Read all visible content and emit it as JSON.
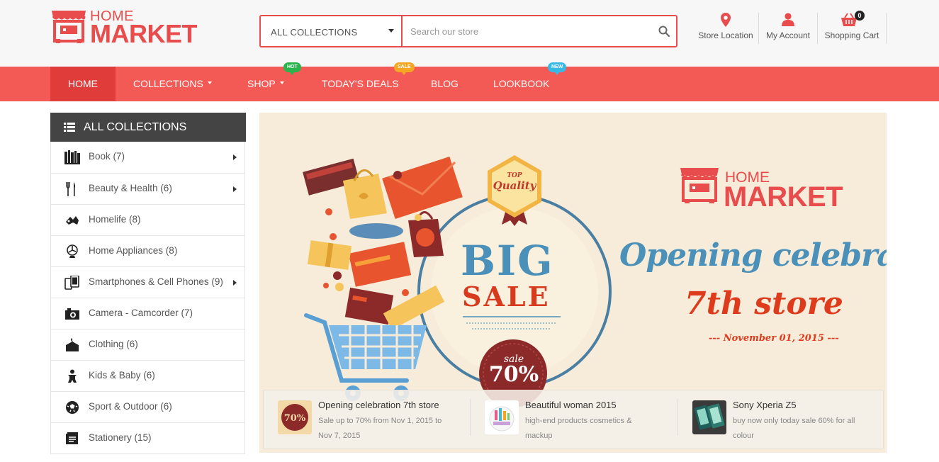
{
  "brand": {
    "home": "HOME",
    "market": "MARKET",
    "color": "#e84c4c"
  },
  "search": {
    "category": "ALL COLLECTIONS",
    "placeholder": "Search our store"
  },
  "header_links": [
    {
      "label": "Store Location",
      "icon": "map-pin-icon"
    },
    {
      "label": "My Account",
      "icon": "user-icon"
    },
    {
      "label": "Shopping Cart",
      "icon": "basket-icon",
      "count": "0"
    }
  ],
  "nav": [
    {
      "label": "HOME",
      "active": true
    },
    {
      "label": "COLLECTIONS",
      "dropdown": true
    },
    {
      "label": "SHOP",
      "dropdown": true,
      "badge": "HOT"
    },
    {
      "label": "TODAY'S DEALS",
      "badge": "SALE"
    },
    {
      "label": "BLOG"
    },
    {
      "label": "LOOKBOOK",
      "badge": "NEW"
    }
  ],
  "sidebar": {
    "title": "ALL COLLECTIONS",
    "items": [
      {
        "label": "Book (7)",
        "icon": "books-icon",
        "submenu": true
      },
      {
        "label": "Beauty & Health (6)",
        "icon": "cutlery-icon",
        "submenu": true
      },
      {
        "label": "Homelife (8)",
        "icon": "homelife-icon"
      },
      {
        "label": "Home Appliances (8)",
        "icon": "fan-icon"
      },
      {
        "label": "Smartphones & Cell Phones (9)",
        "icon": "phones-icon",
        "submenu": true
      },
      {
        "label": "Camera - Camcorder (7)",
        "icon": "camera-icon"
      },
      {
        "label": "Clothing (6)",
        "icon": "clothing-icon"
      },
      {
        "label": "Kids & Baby (6)",
        "icon": "baby-icon"
      },
      {
        "label": "Sport & Outdoor (6)",
        "icon": "soccer-ball-icon"
      },
      {
        "label": "Stationery (15)",
        "icon": "stationery-icon"
      }
    ]
  },
  "banner": {
    "logo_home": "HOME",
    "logo_market": "MARKET",
    "headline": "Opening celebration",
    "subheadline": "7th store",
    "date": "--- November 01, 2015 ---",
    "big": "BIG",
    "sale": "SALE",
    "badge_top": "TOP",
    "badge_quality": "Quality",
    "sale_tag_word": "sale",
    "sale_tag_percent": "70%"
  },
  "promos": [
    {
      "title": "Opening celebration 7th store",
      "desc": "Sale up to 70% from Nov 1, 2015 to Nov 7, 2015",
      "thumb_text": "70%"
    },
    {
      "title": "Beautiful woman 2015",
      "desc": "high-end products cosmetics & mackup"
    },
    {
      "title": "Sony Xperia Z5",
      "desc": "buy now only today sale 60% for all colour"
    }
  ],
  "colors": {
    "accent": "#f45a55",
    "nav_active": "#e03c3a",
    "dark": "#444444",
    "banner_bg": "#f6ecd9",
    "blue": "#4a90b8"
  }
}
